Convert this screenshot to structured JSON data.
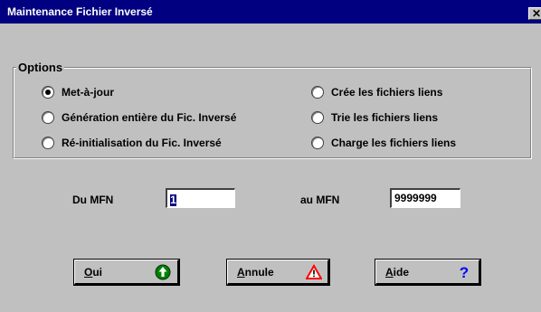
{
  "window": {
    "title": "Maintenance Fichier Inversé",
    "close_glyph": "✕"
  },
  "options": {
    "group_label": "Options",
    "radios": [
      {
        "label": "Met-à-jour",
        "selected": true
      },
      {
        "label": "Génération entière du Fic. Inversé",
        "selected": false
      },
      {
        "label": "Ré-initialisation du Fic. Inversé",
        "selected": false
      },
      {
        "label": "Crée les fichiers liens",
        "selected": false
      },
      {
        "label": "Trie les fichiers liens",
        "selected": false
      },
      {
        "label": "Charge les fichiers liens",
        "selected": false
      }
    ]
  },
  "range": {
    "from_label": "Du MFN",
    "from_value": "1",
    "to_label": "au MFN",
    "to_value": "9999999"
  },
  "buttons": {
    "ok": {
      "mnemonic": "O",
      "rest": "ui",
      "icon": "green-up-arrow-icon"
    },
    "cancel": {
      "mnemonic": "A",
      "rest": "nnule",
      "icon": "red-warning-triangle-icon"
    },
    "help": {
      "mnemonic": "A",
      "rest": "ide",
      "icon": "blue-question-mark-icon"
    }
  },
  "colors": {
    "titlebar": "#000080",
    "face": "#c0c0c0",
    "ok_icon": "#008000",
    "cancel_icon": "#ff0000",
    "help_icon": "#0000ff"
  }
}
